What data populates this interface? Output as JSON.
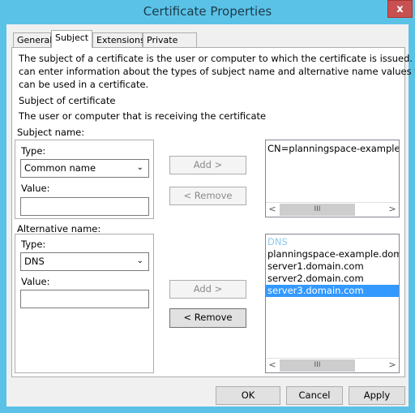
{
  "window": {
    "title": "Certificate Properties",
    "close_label": "x"
  },
  "tabs": [
    {
      "label": "General"
    },
    {
      "label": "Subject"
    },
    {
      "label": "Extensions"
    },
    {
      "label": "Private Key"
    }
  ],
  "intro": [
    "The subject of a certificate is the user or computer to which the certificate is issued. You",
    "can enter information about the types of subject name and alternative name values that",
    "can be used in a certificate."
  ],
  "subject_of_certificate": "Subject of certificate",
  "subject_desc": "The user or computer that is receiving the certificate",
  "subject_name": {
    "label": "Subject name:",
    "type_label": "Type:",
    "type_value": "Common name",
    "value_label": "Value:",
    "value": "",
    "add": "Add >",
    "remove": "< Remove",
    "list": [
      "CN=planningspace-example.d"
    ],
    "scroll_thumb": "III"
  },
  "alt_name": {
    "label": "Alternative name:",
    "type_label": "Type:",
    "type_value": "DNS",
    "value_label": "Value:",
    "value": "",
    "add": "Add >",
    "remove": "< Remove",
    "list_header": "DNS",
    "list": [
      "planningspace-example.domai",
      "server1.domain.com",
      "server2.domain.com",
      "server3.domain.com"
    ],
    "selected": "server3.domain.com",
    "scroll_thumb": "III"
  },
  "buttons": {
    "ok": "OK",
    "cancel": "Cancel",
    "apply": "Apply"
  },
  "colors": {
    "titlebar": "#5bc2e7",
    "close": "#c75050",
    "selection": "#3399ff"
  }
}
